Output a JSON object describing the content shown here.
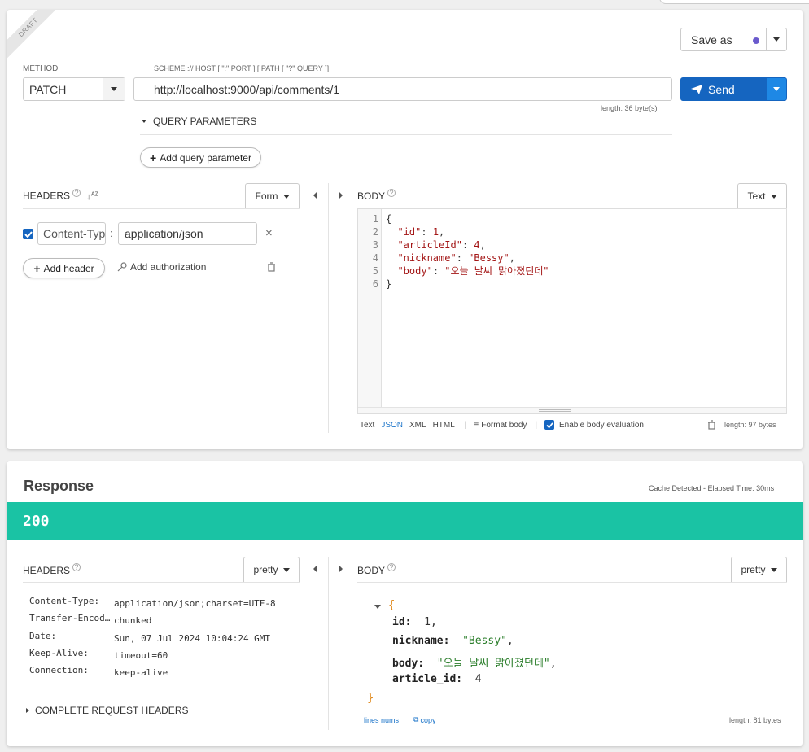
{
  "request": {
    "draft_label": "DRAFT",
    "save_as_label": "Save as",
    "method_label": "METHOD",
    "method_value": "PATCH",
    "url_label": "SCHEME :// HOST [ \":\" PORT ] [ PATH [ \"?\" QUERY ]]",
    "url_value": "http://localhost:9000/api/comments/1",
    "url_length": "length: 36 byte(s)",
    "send_label": "Send",
    "query_params_label": "QUERY PARAMETERS",
    "add_query_param_label": "Add query parameter",
    "headers_title": "HEADERS",
    "headers_mode": "Form",
    "header_name": "Content-Type",
    "header_value": "application/json",
    "add_header_label": "Add header",
    "add_authorization_label": "Add authorization",
    "body_title": "BODY",
    "body_mode": "Text",
    "body_lines": [
      {
        "num": "1",
        "text": "{"
      },
      {
        "num": "2",
        "key": "\"id\"",
        "sep": ": ",
        "val": "1",
        "end": ","
      },
      {
        "num": "3",
        "key": "\"articleId\"",
        "sep": ": ",
        "val": "4",
        "end": ","
      },
      {
        "num": "4",
        "key": "\"nickname\"",
        "sep": ": ",
        "val": "\"Bessy\"",
        "end": ","
      },
      {
        "num": "5",
        "key": "\"body\"",
        "sep": ": ",
        "val": "\"오늘 날씨 맑아졌던데\"",
        "end": ""
      },
      {
        "num": "6",
        "text": "}"
      }
    ],
    "body_formats": {
      "text": "Text",
      "json": "JSON",
      "xml": "XML",
      "html": "HTML"
    },
    "format_body_label": "Format body",
    "enable_eval_label": "Enable body evaluation",
    "body_length": "length: 97 bytes"
  },
  "response": {
    "title": "Response",
    "cache_info": "Cache Detected - Elapsed Time: 30ms",
    "status_code": "200",
    "status_color": "#1ac3a4",
    "headers_title": "HEADERS",
    "headers_mode": "pretty",
    "headers": [
      {
        "k": "Content-Type:",
        "v": "application/json;charset=UTF-8"
      },
      {
        "k": "Transfer-Encod…",
        "v": "chunked"
      },
      {
        "k": "Date:",
        "v": "Sun, 07 Jul 2024 10:04:24 GMT"
      },
      {
        "k": "Keep-Alive:",
        "v": "timeout=60"
      },
      {
        "k": "Connection:",
        "v": "keep-alive"
      }
    ],
    "complete_headers_label": "COMPLETE REQUEST HEADERS",
    "body_title": "BODY",
    "body_mode": "pretty",
    "open_brace": "{",
    "close_brace": "}",
    "fields": [
      {
        "key": "id:",
        "val": "1",
        "comma": ","
      },
      {
        "key": "nickname:",
        "val": "\"Bessy\"",
        "comma": ","
      },
      {
        "key": "body:",
        "val": "\"오늘 날씨 맑아졌던데\"",
        "comma": ","
      },
      {
        "key": "article_id:",
        "val": "4",
        "comma": ""
      }
    ],
    "lines_nums_label": "lines nums",
    "copy_label": "copy",
    "body_length": "length: 81 bytes"
  },
  "colors": {
    "send_blue": "#1565c0",
    "link_blue": "#1a73c8",
    "json_string_green": "#2a7d2a",
    "json_number": "#333333",
    "brace_orange": "#e08a1e",
    "editor_red": "#a31515"
  }
}
